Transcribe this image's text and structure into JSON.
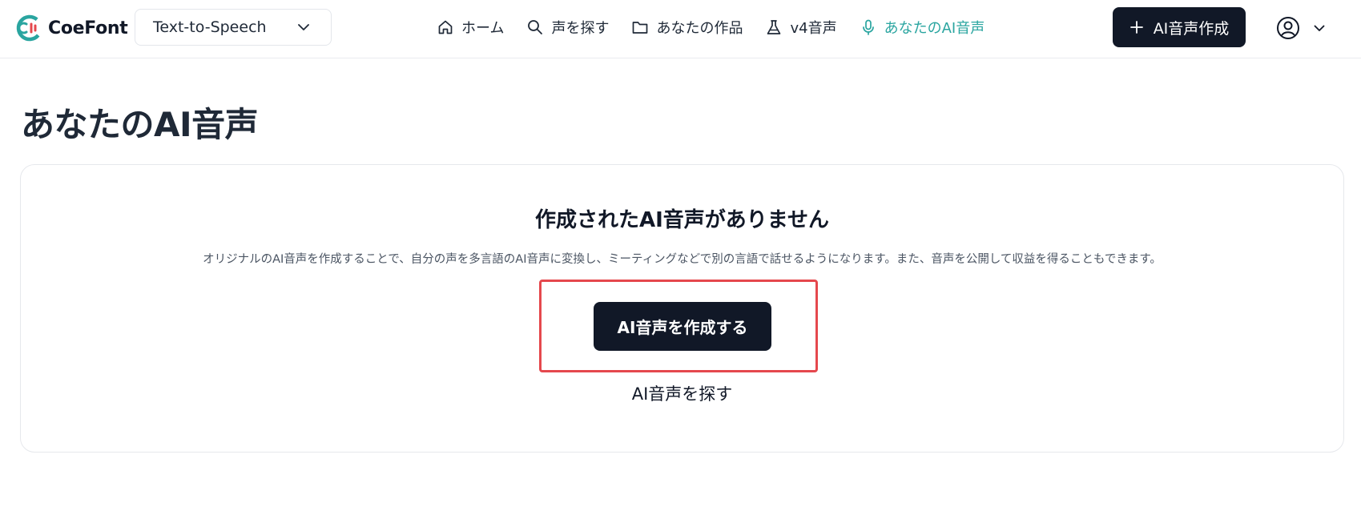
{
  "header": {
    "logo_text": "CoeFont",
    "product_select": {
      "value": "Text-to-Speech"
    },
    "nav": [
      {
        "label": "ホーム",
        "icon": "home-icon"
      },
      {
        "label": "声を探す",
        "icon": "search-icon"
      },
      {
        "label": "あなたの作品",
        "icon": "folder-icon"
      },
      {
        "label": "v4音声",
        "icon": "flask-icon"
      },
      {
        "label": "あなたのAI音声",
        "icon": "microphone-icon",
        "active": true
      }
    ],
    "create_button_label": "AI音声作成"
  },
  "main": {
    "page_title": "あなたのAI音声",
    "empty_state": {
      "title": "作成されたAI音声がありません",
      "description": "オリジナルのAI音声を作成することで、自分の声を多言語のAI音声に変換し、ミーティングなどで別の言語で話せるようになります。また、音声を公開して収益を得ることもできます。",
      "primary_button": "AI音声を作成する",
      "secondary_link": "AI音声を探す"
    }
  },
  "colors": {
    "accent": "#2aa5a0",
    "dark_button": "#111827",
    "highlight": "#e5484d"
  }
}
